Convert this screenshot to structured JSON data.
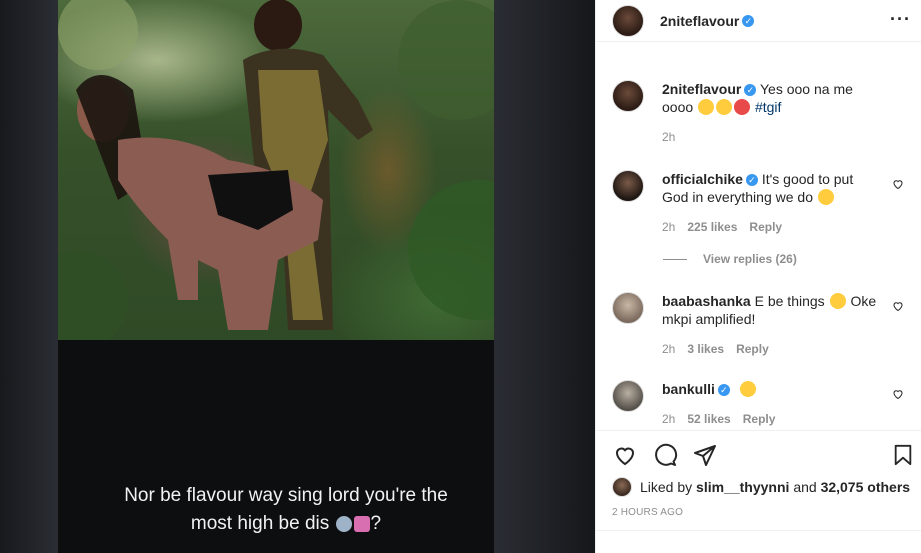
{
  "post": {
    "author": "2niteflavour",
    "more_icon": "more-horizontal-icon"
  },
  "media": {
    "overlay_caption_line1": "Nor be flavour way sing lord you're the",
    "overlay_caption_line2": "most high be dis",
    "overlay_caption_tail": "?"
  },
  "caption": {
    "username": "2niteflavour",
    "text": "Yes ooo na me oooo",
    "hashtag": "#tgif",
    "time": "2h"
  },
  "comments": [
    {
      "username": "officialchike",
      "text": "It's good to put God in everything we do",
      "time": "2h",
      "likes": "225 likes",
      "reply": "Reply",
      "view_replies": "View replies (26)"
    },
    {
      "username": "baabashanka",
      "text": "E be things",
      "text2": "Oke mkpi amplified!",
      "time": "2h",
      "likes": "3 likes",
      "reply": "Reply"
    },
    {
      "username": "bankulli",
      "text": "",
      "time": "2h",
      "likes": "52 likes",
      "reply": "Reply"
    }
  ],
  "likes": {
    "prefix": "Liked by",
    "user": "slim__thyynni",
    "middle": "and",
    "others": "32,075 others"
  },
  "timestamp": "2 HOURS AGO",
  "colors": {
    "verified": "#3897f0",
    "muted": "#8e8e8e",
    "hashtag": "#00376b"
  }
}
